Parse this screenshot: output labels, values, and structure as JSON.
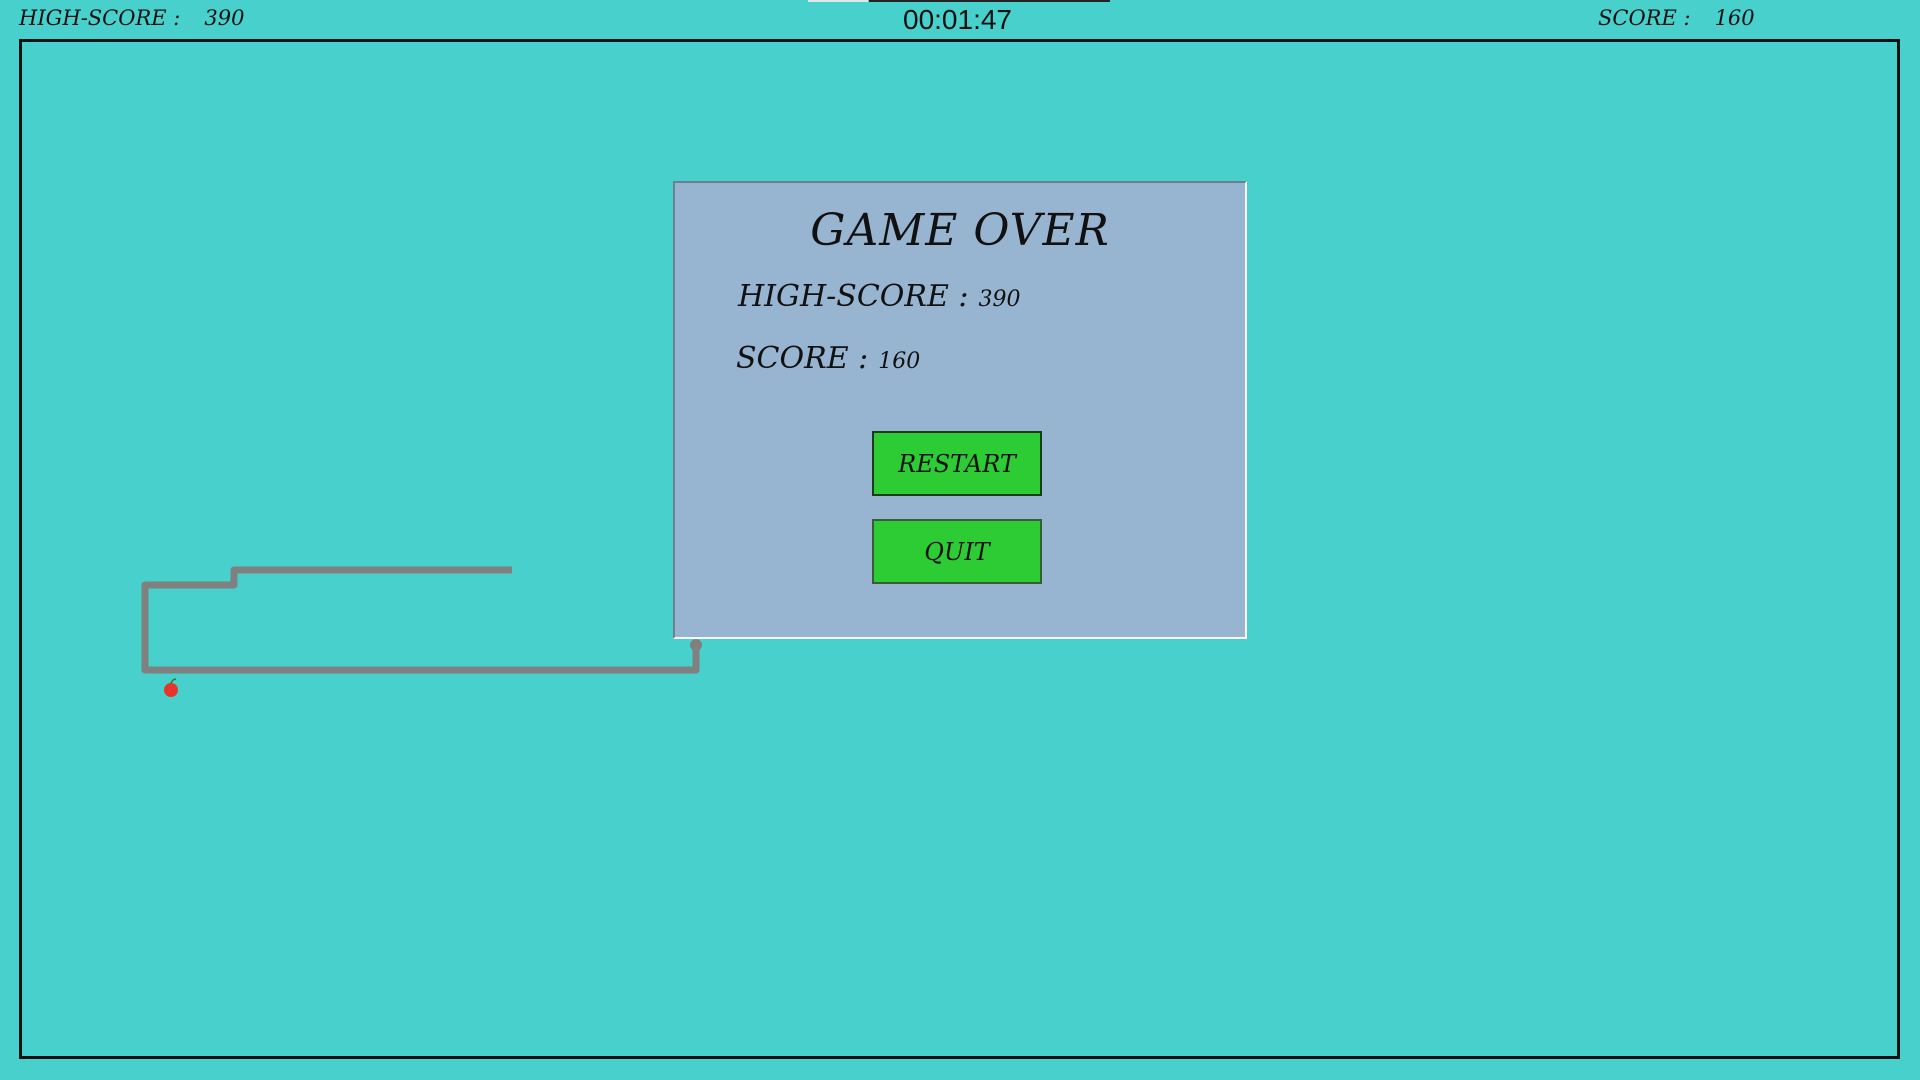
{
  "hud": {
    "high_score_label": "HIGH-SCORE :",
    "high_score_value": "390",
    "timer": "00:01:47",
    "score_label": "SCORE :",
    "score_value": "160"
  },
  "dialog": {
    "title": "GAME OVER",
    "high_score_label": "HIGH-SCORE :",
    "high_score_value": "390",
    "score_label": "SCORE :",
    "score_value": "160",
    "restart_label": "RESTART",
    "quit_label": "QUIT"
  },
  "colors": {
    "background": "#48D0CC",
    "dialog": "#97B4D1",
    "button": "#2ECC34",
    "snake": "#808080",
    "apple": "#E8342A"
  },
  "game": {
    "snake": "gray-line",
    "food": "apple-icon"
  }
}
